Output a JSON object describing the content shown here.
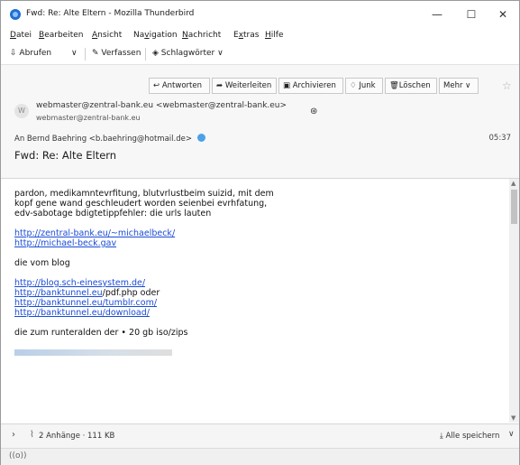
{
  "window": {
    "title": "Fwd: Re: Alte Eltern - Mozilla Thunderbird",
    "minimize": "—",
    "maximize": "☐",
    "close": "✕"
  },
  "menubar": {
    "items": [
      {
        "u": "D",
        "rest": "atei"
      },
      {
        "u": "B",
        "rest": "earbeiten"
      },
      {
        "u": "A",
        "rest": "nsicht"
      },
      {
        "pre": "Na",
        "u": "v",
        "rest": "igation"
      },
      {
        "u": "N",
        "rest": "achricht"
      },
      {
        "pre": "E",
        "u": "x",
        "rest": "tras"
      },
      {
        "u": "H",
        "rest": "ilfe"
      }
    ]
  },
  "toolbar": {
    "get_messages": "Abrufen",
    "write": "Verfassen",
    "tags": "Schlagwörter"
  },
  "header": {
    "actions": {
      "reply": "Antworten",
      "forward": "Weiterleiten",
      "archive": "Archivieren",
      "junk": "Junk",
      "delete": "Löschen",
      "more": "Mehr"
    },
    "from": "webmaster@zentral-bank.eu <webmaster@zentral-bank.eu>",
    "from_short": "webmaster@zentral-bank.eu",
    "to_label": "An",
    "to": "Bernd Baehring <b.baehring@hotmail.de>",
    "time": "05:37",
    "subject": "Fwd: Re: Alte Eltern"
  },
  "body": {
    "lines": [
      "pardon, medikamntevrfitung, blutvrlustbeim suizid, mit dem",
      "kopf gene wand geschleudert worden seienbei evrhfatung,",
      "edv-sabotage bdigtetippfehler: die urls lauten"
    ],
    "links1": [
      "http://zentral-bank.eu/~michaelbeck/",
      "http://michael-beck.gav"
    ],
    "blog_label": "die vom blog",
    "links2": [
      {
        "link": "http://blog.sch-einesystem.de/",
        "suffix": ""
      },
      {
        "link": "http://banktunnel.eu",
        "suffix": "/pdf.php oder"
      },
      {
        "link": "http://banktunnel.eu/tumblr.com/",
        "suffix": ""
      },
      {
        "link": "http://banktunnel.eu/download/",
        "suffix": ""
      }
    ],
    "download_line": "die zum runteralden der • 20 gb iso/zips"
  },
  "attachments": {
    "summary": "2 Anhänge · 111 KB",
    "save_all": "Alle speichern"
  },
  "status": {
    "icon": "((o))"
  },
  "colors": {
    "link": "#1a4bd6",
    "app_icon": "#1f6fd1",
    "header_bg": "#f7f7f7"
  }
}
